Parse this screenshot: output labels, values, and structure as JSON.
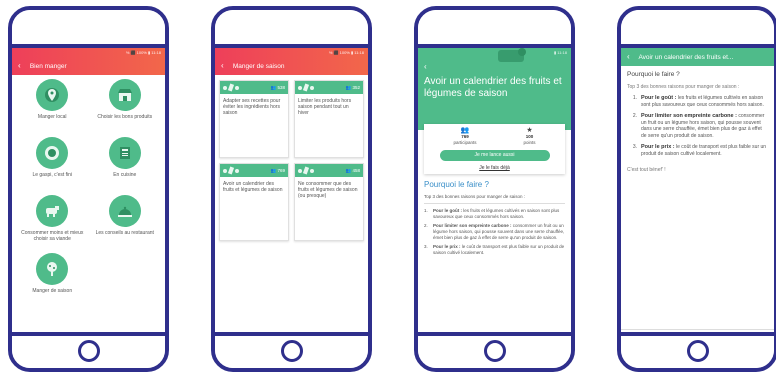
{
  "colors": {
    "frame": "#2f2f8c",
    "appbar_red": "#ee3f5a",
    "appbar_orange": "#f2674a",
    "green": "#4fbb8a",
    "title_blue": "#3a8fc8"
  },
  "screen1": {
    "status": "% ⬛ 100% ▮ 11:18",
    "title": "Bien manger",
    "items": [
      {
        "label": "Manger local",
        "icon": "map-pin-icon"
      },
      {
        "label": "Choisir les bons produits",
        "icon": "shop-icon"
      },
      {
        "label": "Le gaspi, c'est fini",
        "icon": "plate-icon"
      },
      {
        "label": "En cuisine",
        "icon": "book-icon"
      },
      {
        "label": "Consommer moins et mieux choisir sa viande",
        "icon": "cow-icon"
      },
      {
        "label": "Les conseils au restaurant",
        "icon": "restaurant-icon"
      },
      {
        "label": "Manger de saison",
        "icon": "tree-icon"
      }
    ]
  },
  "screen2": {
    "status": "% ⬛ 100% ▮ 11:18",
    "title": "Manger de saison",
    "cards": [
      {
        "count": "538",
        "text": "Adapter ses recettes pour éviter les ingrédients hors saison"
      },
      {
        "count": "352",
        "text": "Limiter les produits hors saison pendant tout un hiver"
      },
      {
        "count": "769",
        "text": "Avoir un calendrier des fruits et légumes de saison"
      },
      {
        "count": "458",
        "text": "Ne consommer que des fruits et légumes de saison (ou presque)"
      }
    ]
  },
  "screen3": {
    "status": "▮ 11:18",
    "title": "Avoir un calendrier des fruits et légumes de saison",
    "participants_value": "769",
    "participants_label": "participants",
    "points_value": "100",
    "points_label": "points",
    "cta": "Je me lance aussi",
    "link": "Je le fais déjà",
    "section_title": "Pourquoi le faire ?",
    "intro": "Top 3 des bonnes raisons pour manger de saison :",
    "reasons": [
      {
        "n": "1.",
        "bold": "Pour le goût :",
        "text": " les fruits et légumes cultivés en saison sont plus savoureux que ceux consommés hors saison."
      },
      {
        "n": "2.",
        "bold": "Pour limiter son empreinte carbone :",
        "text": " consommer un fruit ou un légume hors saison, qui pousse souvent dans une serre chauffée, émet bien plus de gaz à effet de serre qu'un produit de saison."
      },
      {
        "n": "3.",
        "bold": "Pour le prix :",
        "text": " le coût de transport est plus faible sur un produit de saison cultivé localement."
      }
    ]
  },
  "screen4": {
    "title": "Avoir un calendrier des fruits et...",
    "section_title": "Pourquoi le faire ?",
    "intro": "Top 3 des bonnes raisons pour manger de saison :",
    "reasons": [
      {
        "n": "1.",
        "bold": "Pour le goût :",
        "text": " les fruits et légumes cultivés en saison sont plus savoureux que ceux consommés hors saison."
      },
      {
        "n": "2.",
        "bold": "Pour limiter son empreinte carbone :",
        "text": " consommer un fruit ou un légume hors saison, qui pousse souvent dans une serre chauffée, émet bien plus de gaz à effet de serre qu'un produit de saison."
      },
      {
        "n": "3.",
        "bold": "Pour le prix :",
        "text": " le coût de transport est plus faible sur un produit de saison cultivé localement."
      }
    ],
    "closing": "C'est tout bénef' !"
  }
}
